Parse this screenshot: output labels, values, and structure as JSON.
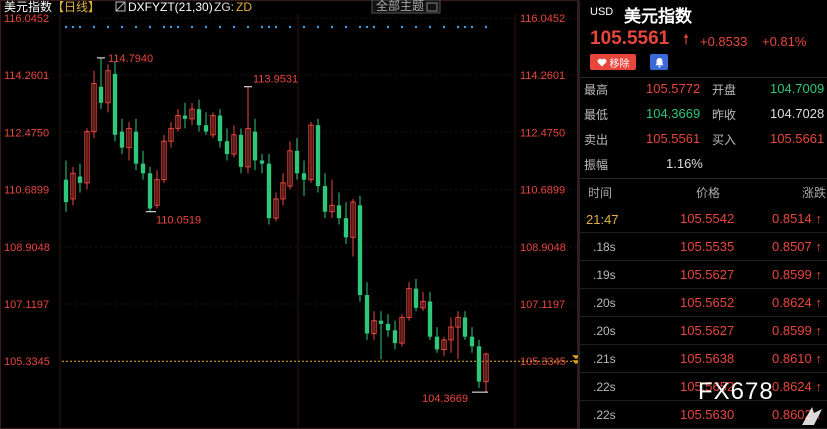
{
  "header": {
    "title": "美元指数",
    "period": "【日线】",
    "indicator_name": "DXFYZT(21,30)",
    "zg_label": "ZG:",
    "zd_label": "ZD",
    "theme_dropdown": "全部主题"
  },
  "y_axis_labels": [
    "116.0452",
    "114.2601",
    "112.4750",
    "110.6899",
    "108.9048",
    "107.1197",
    "105.3345"
  ],
  "annotations": {
    "high": "114.7940",
    "high2": "113.9531",
    "low1": "110.0519",
    "low2": "104.3669"
  },
  "colors": {
    "up": "#e8463d",
    "down": "#2fc77a",
    "dots": "#3aa0e8",
    "last_line": "#e0b040"
  },
  "chart_data": {
    "type": "candlestick",
    "ylim": [
      104.0,
      116.0452
    ],
    "last_price_line": 105.3345,
    "candles": [
      {
        "o": 111.0,
        "h": 111.6,
        "l": 110.0,
        "c": 110.3
      },
      {
        "o": 110.4,
        "h": 111.4,
        "l": 110.2,
        "c": 111.2
      },
      {
        "o": 111.1,
        "h": 111.5,
        "l": 110.6,
        "c": 110.9
      },
      {
        "o": 110.9,
        "h": 112.6,
        "l": 110.7,
        "c": 112.5
      },
      {
        "o": 112.5,
        "h": 114.4,
        "l": 112.3,
        "c": 114.0
      },
      {
        "o": 113.9,
        "h": 114.8,
        "l": 113.2,
        "c": 113.4
      },
      {
        "o": 113.4,
        "h": 114.6,
        "l": 113.1,
        "c": 114.4
      },
      {
        "o": 114.3,
        "h": 114.7,
        "l": 112.2,
        "c": 112.4
      },
      {
        "o": 112.5,
        "h": 112.9,
        "l": 111.8,
        "c": 112.0
      },
      {
        "o": 112.0,
        "h": 112.8,
        "l": 111.6,
        "c": 112.6
      },
      {
        "o": 112.5,
        "h": 112.9,
        "l": 111.3,
        "c": 111.5
      },
      {
        "o": 111.5,
        "h": 111.9,
        "l": 111.0,
        "c": 111.2
      },
      {
        "o": 111.2,
        "h": 111.4,
        "l": 110.0,
        "c": 110.1
      },
      {
        "o": 110.2,
        "h": 111.3,
        "l": 110.1,
        "c": 111.0
      },
      {
        "o": 111.0,
        "h": 112.4,
        "l": 110.9,
        "c": 112.2
      },
      {
        "o": 112.2,
        "h": 112.8,
        "l": 112.0,
        "c": 112.6
      },
      {
        "o": 112.6,
        "h": 113.2,
        "l": 112.5,
        "c": 113.0
      },
      {
        "o": 113.0,
        "h": 113.4,
        "l": 112.6,
        "c": 112.9
      },
      {
        "o": 112.9,
        "h": 113.4,
        "l": 112.7,
        "c": 113.2
      },
      {
        "o": 113.2,
        "h": 113.5,
        "l": 112.5,
        "c": 112.7
      },
      {
        "o": 112.7,
        "h": 113.1,
        "l": 112.4,
        "c": 112.5
      },
      {
        "o": 112.4,
        "h": 113.1,
        "l": 112.3,
        "c": 113.0
      },
      {
        "o": 113.0,
        "h": 113.2,
        "l": 112.0,
        "c": 112.2
      },
      {
        "o": 112.2,
        "h": 112.6,
        "l": 111.6,
        "c": 111.8
      },
      {
        "o": 111.8,
        "h": 112.7,
        "l": 111.7,
        "c": 112.4
      },
      {
        "o": 112.4,
        "h": 112.6,
        "l": 111.2,
        "c": 111.4
      },
      {
        "o": 111.4,
        "h": 113.9,
        "l": 111.2,
        "c": 112.6
      },
      {
        "o": 112.5,
        "h": 112.9,
        "l": 111.3,
        "c": 111.6
      },
      {
        "o": 111.6,
        "h": 111.8,
        "l": 111.2,
        "c": 111.5
      },
      {
        "o": 111.5,
        "h": 111.8,
        "l": 109.6,
        "c": 109.8
      },
      {
        "o": 109.8,
        "h": 110.6,
        "l": 109.7,
        "c": 110.4
      },
      {
        "o": 110.4,
        "h": 111.2,
        "l": 110.2,
        "c": 110.9
      },
      {
        "o": 110.8,
        "h": 112.2,
        "l": 110.7,
        "c": 111.9
      },
      {
        "o": 111.9,
        "h": 112.3,
        "l": 111.0,
        "c": 111.2
      },
      {
        "o": 111.2,
        "h": 111.6,
        "l": 110.5,
        "c": 111.0
      },
      {
        "o": 111.0,
        "h": 112.8,
        "l": 110.9,
        "c": 112.7
      },
      {
        "o": 112.7,
        "h": 112.9,
        "l": 110.6,
        "c": 110.8
      },
      {
        "o": 110.8,
        "h": 111.2,
        "l": 109.8,
        "c": 110.0
      },
      {
        "o": 110.0,
        "h": 111.0,
        "l": 109.8,
        "c": 110.2
      },
      {
        "o": 110.2,
        "h": 110.6,
        "l": 109.6,
        "c": 109.8
      },
      {
        "o": 109.8,
        "h": 110.3,
        "l": 109.0,
        "c": 109.2
      },
      {
        "o": 109.2,
        "h": 110.4,
        "l": 108.6,
        "c": 110.3
      },
      {
        "o": 110.2,
        "h": 110.5,
        "l": 107.2,
        "c": 107.4
      },
      {
        "o": 107.4,
        "h": 107.8,
        "l": 106.0,
        "c": 106.2
      },
      {
        "o": 106.2,
        "h": 106.9,
        "l": 106.0,
        "c": 106.6
      },
      {
        "o": 106.6,
        "h": 106.9,
        "l": 105.4,
        "c": 106.5
      },
      {
        "o": 106.5,
        "h": 106.8,
        "l": 106.1,
        "c": 106.3
      },
      {
        "o": 106.3,
        "h": 106.6,
        "l": 105.7,
        "c": 105.9
      },
      {
        "o": 105.9,
        "h": 106.8,
        "l": 105.8,
        "c": 106.7
      },
      {
        "o": 106.7,
        "h": 107.8,
        "l": 106.6,
        "c": 107.6
      },
      {
        "o": 107.6,
        "h": 107.9,
        "l": 106.9,
        "c": 107.0
      },
      {
        "o": 107.0,
        "h": 107.5,
        "l": 106.9,
        "c": 107.2
      },
      {
        "o": 107.2,
        "h": 107.5,
        "l": 106.0,
        "c": 106.1
      },
      {
        "o": 106.1,
        "h": 106.4,
        "l": 105.6,
        "c": 105.7
      },
      {
        "o": 105.7,
        "h": 106.1,
        "l": 105.5,
        "c": 106.0
      },
      {
        "o": 106.0,
        "h": 106.7,
        "l": 105.6,
        "c": 106.4
      },
      {
        "o": 106.4,
        "h": 106.9,
        "l": 105.4,
        "c": 106.7
      },
      {
        "o": 106.7,
        "h": 106.9,
        "l": 106.0,
        "c": 106.1
      },
      {
        "o": 106.1,
        "h": 106.4,
        "l": 105.6,
        "c": 105.8
      },
      {
        "o": 105.8,
        "h": 106.0,
        "l": 104.5,
        "c": 104.7
      },
      {
        "o": 104.7,
        "h": 105.6,
        "l": 104.37,
        "c": 105.56
      }
    ]
  },
  "quote": {
    "currency": "USD",
    "name": "美元指数",
    "price": "105.5561",
    "change": "+0.8533",
    "change_pct": "+0.81%",
    "remove_label": "移除",
    "stats": {
      "high_label": "最高",
      "high": "105.5772",
      "open_label": "开盘",
      "open": "104.7009",
      "low_label": "最低",
      "low": "104.3669",
      "prev_label": "昨收",
      "prev": "104.7028",
      "sell_label": "卖出",
      "sell": "105.5561",
      "buy_label": "买入",
      "buy": "105.5661",
      "amp_label": "振幅",
      "amp": "1.16%"
    },
    "ticks_header": {
      "time": "时间",
      "price": "价格",
      "chg": "涨跌"
    },
    "ticks": [
      {
        "t": "21:47",
        "p": "105.5542",
        "c": "0.8514"
      },
      {
        "t": ".18s",
        "p": "105.5535",
        "c": "0.8507"
      },
      {
        "t": ".19s",
        "p": "105.5627",
        "c": "0.8599"
      },
      {
        "t": ".20s",
        "p": "105.5652",
        "c": "0.8624"
      },
      {
        "t": ".20s",
        "p": "105.5627",
        "c": "0.8599"
      },
      {
        "t": ".21s",
        "p": "105.5638",
        "c": "0.8610"
      },
      {
        "t": ".22s",
        "p": "105.5652",
        "c": "0.8624"
      },
      {
        "t": ".22s",
        "p": "105.5630",
        "c": "0.8602"
      }
    ]
  },
  "watermark": "FX678"
}
